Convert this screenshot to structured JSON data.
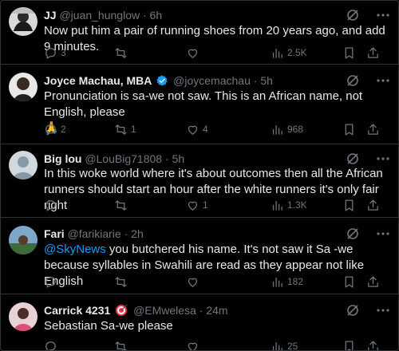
{
  "tweets": [
    {
      "name": "JJ",
      "handle": "@juan_hunglow",
      "sep": "·",
      "time": "6h",
      "text": "Now put him a pair of running shoes from 20 years ago, and add 9 minutes.",
      "replies": "3",
      "retweets": "",
      "likes": "",
      "views": "2.5K"
    },
    {
      "name": "Joyce Machau, MBA",
      "handle": "@joycemachau",
      "sep": "·",
      "time": "5h",
      "text": "Pronunciation is sa-we not saw. This is an African name, not English, please",
      "emoji": "🙏",
      "replies": "2",
      "retweets": "1",
      "likes": "4",
      "views": "968"
    },
    {
      "name": "Big lou",
      "handle": "@LouBig71808",
      "sep": "·",
      "time": "5h",
      "text": "In this woke world where it's about outcomes then all the African runners should start an hour after the white runners it's only fair right",
      "replies": "",
      "retweets": "",
      "likes": "1",
      "views": "1.3K"
    },
    {
      "name": "Fari",
      "handle": "@farikiarie",
      "sep": "·",
      "time": "2h",
      "mention": "@SkyNews",
      "text": " you butchered his name. It's not saw it Sa -we because syllables in Swahili are read as they appear not like English",
      "replies": "",
      "retweets": "",
      "likes": "",
      "views": "182"
    },
    {
      "name": "Carrick 4231",
      "handle": "@EMwelesa",
      "sep": "·",
      "time": "24m",
      "text": "Sebastian Sa-we please",
      "replies": "",
      "retweets": "",
      "likes": "",
      "views": "25"
    }
  ],
  "icons": {
    "reply": "reply-icon",
    "retweet": "retweet-icon",
    "like": "heart-icon",
    "views": "views-icon",
    "bookmark": "bookmark-icon",
    "share": "share-icon",
    "grok": "grok-icon",
    "more": "more-icon",
    "verified": "verified-badge-icon"
  },
  "colors": {
    "background": "#000000",
    "text": "#e7e9ea",
    "muted": "#71767b",
    "link": "#1d9bf0",
    "border": "#2f3336"
  }
}
